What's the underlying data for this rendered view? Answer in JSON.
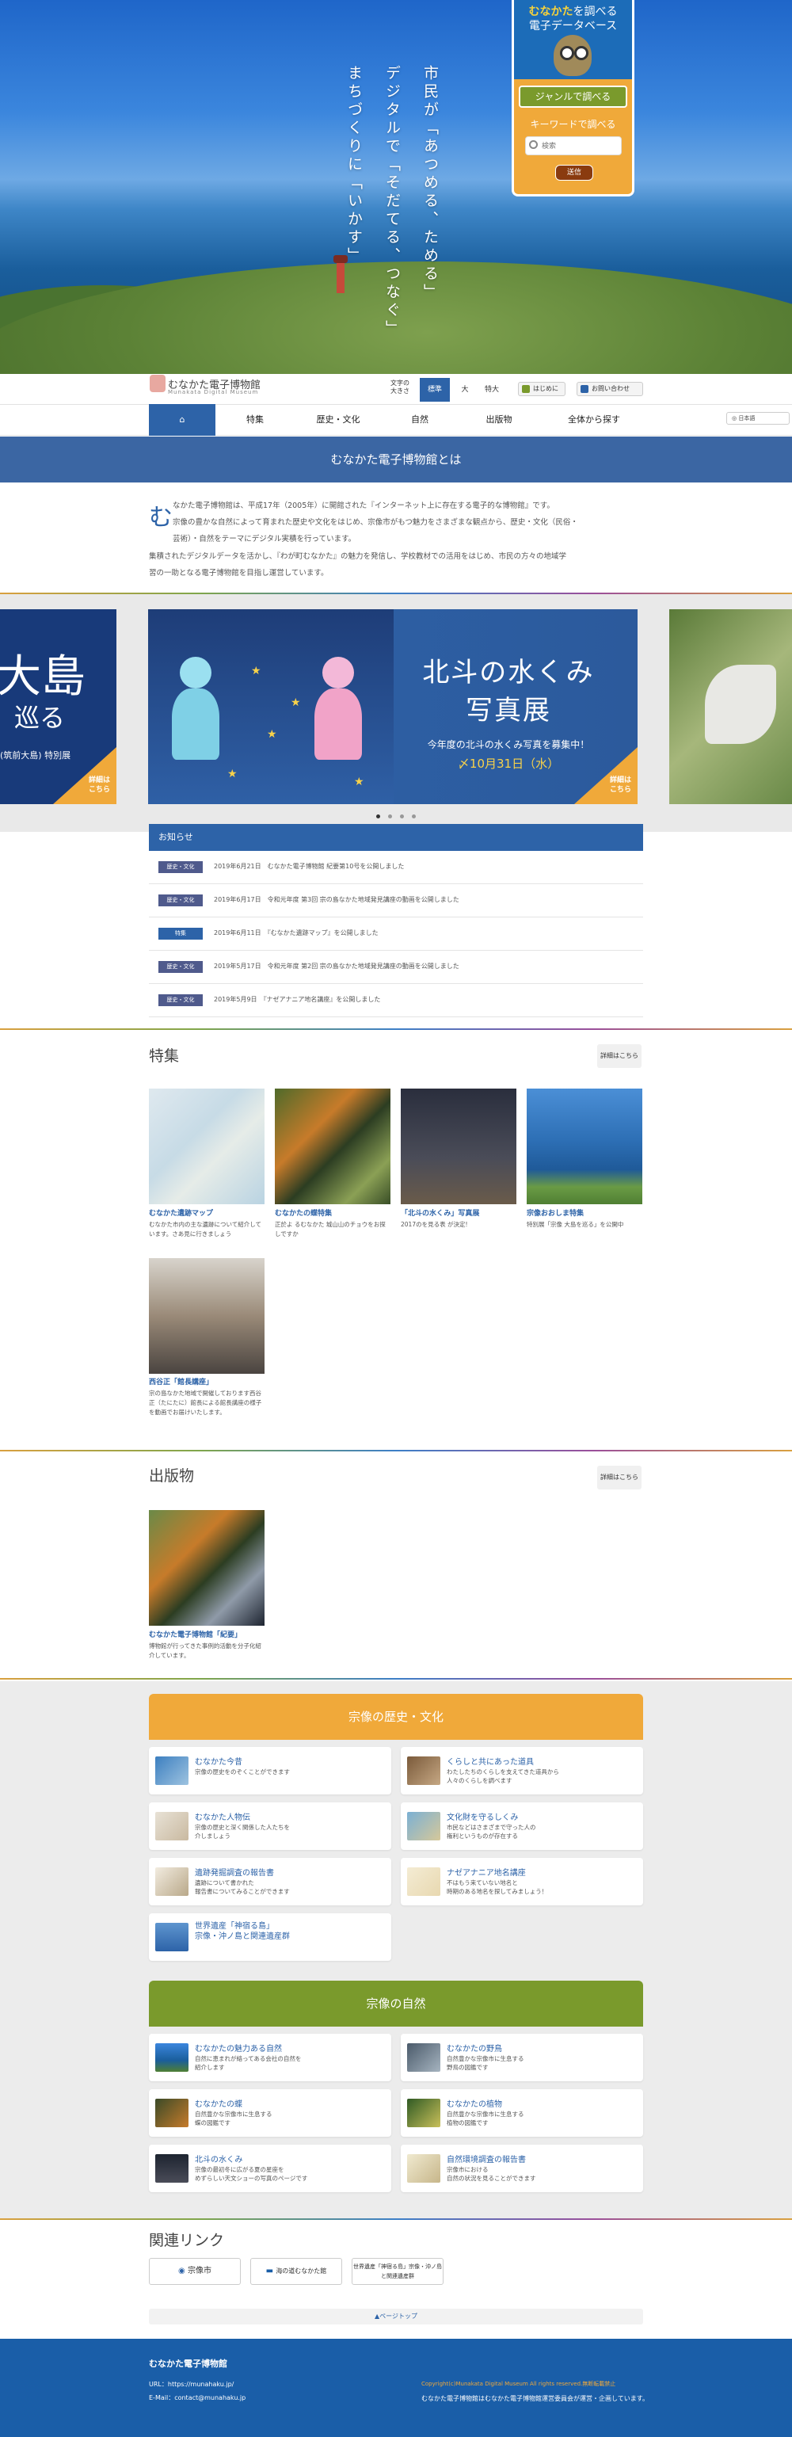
{
  "hero": {
    "line1": "市民が「あつめる、ためる」",
    "line2": "デジタルで「そだてる、つなぐ」",
    "line3": "まちづくりに「いかす」"
  },
  "search_panel": {
    "title_em": "むなかた",
    "title_rest": "を調べる",
    "subtitle": "電子データベース",
    "genre_button": "ジャンルで調べる",
    "keyword_label": "キーワードで調べる",
    "keyword_placeholder": "検索",
    "search_button": "送信"
  },
  "header": {
    "logo": "むなかた電子博物館",
    "logo_sub": "Munakata Digital Museum",
    "font_size_label": "文字の大きさ",
    "font_sizes": [
      "標準",
      "大",
      "特大"
    ],
    "begin": "はじめに",
    "contact": "お問い合わせ"
  },
  "nav": {
    "items": [
      "特集",
      "歴史・文化",
      "自然",
      "出版物",
      "全体から探す"
    ],
    "lang": "日本語"
  },
  "about": {
    "title": "むなかた電子博物館とは",
    "initial": "む",
    "text1": "なかた電子博物館は、平成17年（2005年）に開館された『インターネット上に存在する電子的な博物館』です。",
    "text2": "宗像の豊かな自然によって育まれた歴史や文化をはじめ、宗像市がもつ魅力をさまざまな観点から、歴史・文化（民俗・",
    "text3": "芸術）・自然をテーマにデジタル実積を行っています。",
    "text4": "集積されたデジタルデータを活かし、『わが町むなかた』の魅力を発信し、学校教材での活用をはじめ、市民の方々の地域学",
    "text5": "習の一助となる電子博物館を目指し運営しています。"
  },
  "carousel": {
    "left_title": "大島",
    "left_title2": "巡る",
    "left_sub": "(筑前大島) 特別展",
    "more": "詳細は\nこちら",
    "center_title1": "北斗の水くみ",
    "center_title2": "写真展",
    "center_sub": "今年度の北斗の水くみ写真を募集中！",
    "center_date": "〆10月31日（水）"
  },
  "news": {
    "heading": "お知らせ",
    "items": [
      {
        "tag": "歴史・文化",
        "text": "2019年6月21日　むなかた電子博物館 紀要第10号を公開しました"
      },
      {
        "tag": "歴史・文化",
        "text": "2019年6月17日　令和元年度 第3回 宗の島なかた地域発見講座の動画を公開しました"
      },
      {
        "tag": "特集",
        "text": "2019年6月11日　『むなかた遺跡マップ』を公開しました"
      },
      {
        "tag": "歴史・文化",
        "text": "2019年5月17日　令和元年度 第2回 宗の島なかた地域発見講座の動画を公開しました"
      },
      {
        "tag": "歴史・文化",
        "text": "2019年5月9日　『ナゼアナニア地名講座』を公開しました"
      }
    ]
  },
  "features": {
    "title": "特集",
    "more": "詳細はこちら",
    "items": [
      {
        "title": "むなかた遺跡マップ",
        "desc": "むなかた市内の主な遺跡について紹介しています。さあ見に行きましょう"
      },
      {
        "title": "むなかたの蝶特集",
        "desc": "正於よ るむなかた 城山山のチョウをお探しですか"
      },
      {
        "title": "「北斗の水くみ」写真展",
        "desc": "2017のを見る表 が決定!"
      },
      {
        "title": "宗像おおしま特集",
        "desc": "特別展「宗像 大島を巡る」を公開中"
      },
      {
        "title": "西谷正「館長講座」",
        "desc": "宗の島なかた地域で開催しております西谷正（たにたに）館長による館長講座の様子を動画でお届けいたします。"
      }
    ]
  },
  "publications": {
    "title": "出版物",
    "more": "詳細はこちら",
    "items": [
      {
        "title": "むなかた電子博物館「紀要」",
        "desc": "博物館が行ってきた事例的活動を分子化紹介しています。"
      }
    ]
  },
  "history": {
    "title": "宗像の歴史・文化",
    "items": [
      {
        "title": "むなかた今昔",
        "desc": "宗像の歴史をのぞくことができます"
      },
      {
        "title": "くらしと共にあった道具",
        "desc": "わたしたちのくらしを支えてきた道具から\n人々のくらしを調べます"
      },
      {
        "title": "むなかた人物伝",
        "desc": "宗像の歴史と深く関係した人たちを\n介しましょう"
      },
      {
        "title": "文化財を守るしくみ",
        "desc": "市民などはさまざまで守った人の\n権利というものが存在する"
      },
      {
        "title": "遺跡発掘調査の報告書",
        "desc": "遺跡について書かれた\n報告書についてみることができます"
      },
      {
        "title": "ナゼアナニア地名講座",
        "desc": "不はもう来ていない地名と\n時期のある地名を探してみましょう！"
      },
      {
        "title": "世界遺産「神宿る島」\n宗像・沖ノ島と関連遺産群",
        "desc": ""
      }
    ]
  },
  "nature": {
    "title": "宗像の自然",
    "items": [
      {
        "title": "むなかたの魅力ある自然",
        "desc": "自然に恵まれが絡ってある会社の自然を\n紹介します"
      },
      {
        "title": "むなかたの野鳥",
        "desc": "自然豊かな宗像市に生息する\n野鳥の図鑑です"
      },
      {
        "title": "むなかたの蝶",
        "desc": "自然豊かな宗像市に生息する\n蝶の図鑑です"
      },
      {
        "title": "むなかたの植物",
        "desc": "自然豊かな宗像市に生息する\n植物の図鑑です"
      },
      {
        "title": "北斗の水くみ",
        "desc": "宗像の最初冬に広がる夏の星座を\nめずらしい天文ショーの写真のページです"
      },
      {
        "title": "自然環境調査の報告書",
        "desc": "宗像市における\n自然の状況を見ることができます"
      }
    ]
  },
  "links": {
    "title": "関連リンク",
    "items": [
      "宗像市",
      "海の道むなかた館",
      "世界遺産「神宿る島」宗像・沖ノ島と関連遺産群"
    ]
  },
  "pagetop": "▲ページトップ",
  "footer": {
    "title": "むなかた電子博物館",
    "url": "URL：https://munahaku.jp/",
    "mail": "E-Mail：contact@munahaku.jp",
    "copyright": "Copyright(c)Munakata Digital Museum All rights reserved.無断転載禁止",
    "note": "むなかた電子博物館はむなかた電子博物館運営委員会が運営・企画しています。"
  },
  "colors": {
    "brand_blue": "#2d63a8",
    "orange": "#f0a93a",
    "green": "#7a9a2c"
  }
}
